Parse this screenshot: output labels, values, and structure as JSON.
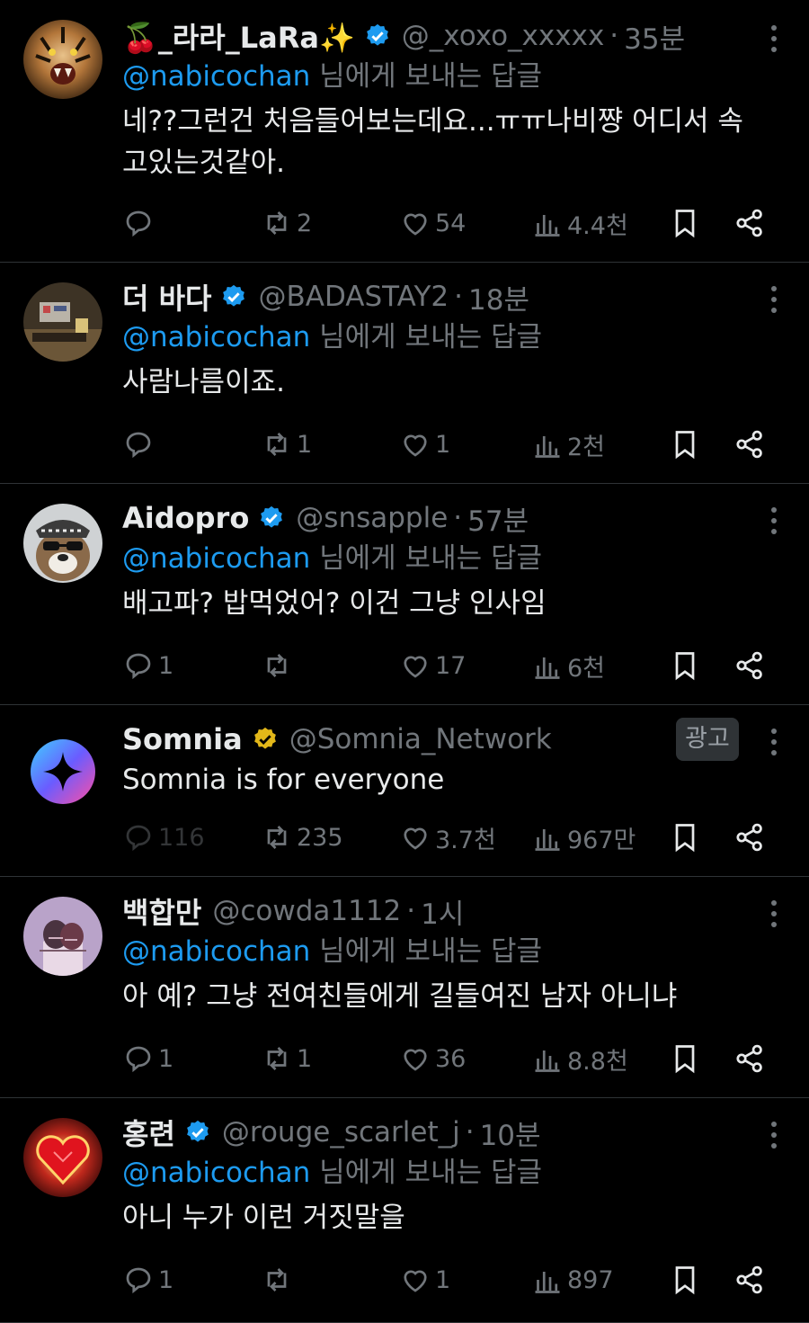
{
  "tweets": [
    {
      "name": "🍒_라라_LaRa✨",
      "verified": "blue",
      "handle": "@_xoxo_xxxxx",
      "time": "35분",
      "mention": "@nabicochan",
      "reply_suffix": " 님에게 보내는 답글",
      "text": "네??그런건 처음들어보는데요...ㅠㅠ나비쨩 어디서 속고있는것같아.",
      "stats": {
        "replies": "",
        "reposts": "2",
        "likes": "54",
        "views": "4.4천"
      }
    },
    {
      "name": "더 바다",
      "verified": "blue",
      "handle": "@BADASTAY2",
      "time": "18분",
      "mention": "@nabicochan",
      "reply_suffix": " 님에게 보내는 답글",
      "text": "사람나름이죠.",
      "stats": {
        "replies": "",
        "reposts": "1",
        "likes": "1",
        "views": "2천"
      }
    },
    {
      "name": "Aidopro",
      "verified": "blue",
      "handle": "@snsapple",
      "time": "57분",
      "mention": "@nabicochan",
      "reply_suffix": " 님에게 보내는 답글",
      "text": "배고파? 밥먹었어? 이건 그냥 인사임",
      "stats": {
        "replies": "1",
        "reposts": "",
        "likes": "17",
        "views": "6천"
      }
    },
    {
      "name": "Somnia",
      "verified": "gold",
      "handle": "@Somnia_Network",
      "ad_label": "광고",
      "text": "Somnia is for everyone",
      "stats": {
        "replies": "116",
        "reposts": "235",
        "likes": "3.7천",
        "views": "967만"
      }
    },
    {
      "name": "백합만",
      "handle": "@cowda1112",
      "time": "1시",
      "mention": "@nabicochan",
      "reply_suffix": " 님에게 보내는 답글",
      "text": "아 예? 그냥 전여친들에게 길들여진 남자 아니냐",
      "stats": {
        "replies": "1",
        "reposts": "1",
        "likes": "36",
        "views": "8.8천"
      }
    },
    {
      "name": "홍련",
      "verified": "blue",
      "handle": "@rouge_scarlet_j",
      "time": "10분",
      "mention": "@nabicochan",
      "reply_suffix": " 님에게 보내는 답글",
      "text": "아니 누가 이런 거짓말을",
      "stats": {
        "replies": "1",
        "reposts": "",
        "likes": "1",
        "views": "897"
      }
    }
  ],
  "separator": "·",
  "colors": {
    "background": "#000000",
    "link": "#1d9bf0",
    "muted": "#71767b",
    "text": "#e7e9ea",
    "verified_blue": "#1d9bf0",
    "verified_gold": "#e2b719",
    "divider": "#2f3336"
  },
  "icons": [
    "reply-icon",
    "repost-icon",
    "like-icon",
    "views-icon",
    "bookmark-icon",
    "share-icon",
    "more-icon",
    "verified-badge-icon"
  ]
}
